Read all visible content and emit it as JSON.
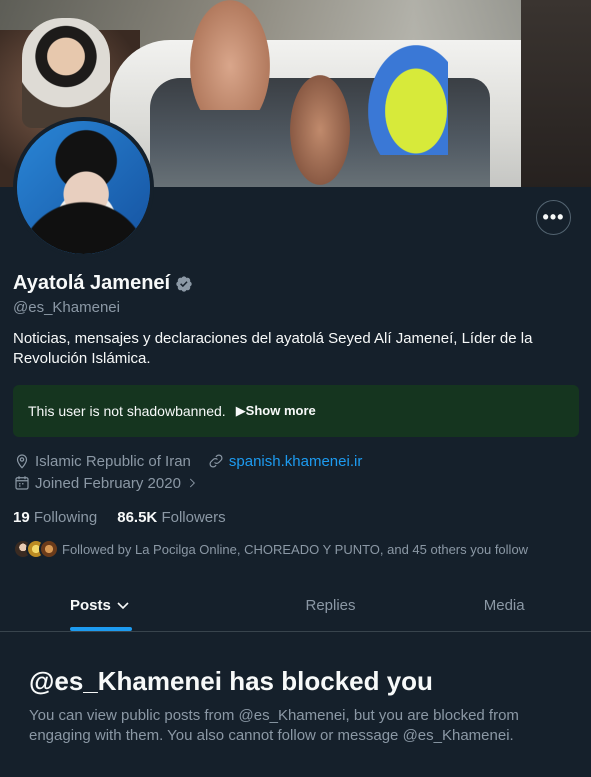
{
  "profile": {
    "name": "Ayatolá Jameneí",
    "handle": "@es_Khamenei",
    "bio": "Noticias, mensajes y declaraciones del ayatolá Seyed Alí Jameneí, Líder de la Revolución Islámica.",
    "location": "Islamic Republic of Iran",
    "website": "spanish.khamenei.ir",
    "joined": "Joined February 2020",
    "following_count": "19",
    "following_label": "Following",
    "followers_count": "86.5K",
    "followers_label": "Followers",
    "followed_by": "Followed by La Pocilga Online, CHOREADO Y PUNTO, and 45 others you follow"
  },
  "more_button": "•••",
  "shadowban": {
    "message": "This user is not shadowbanned.",
    "show_more": "▶Show more"
  },
  "tabs": [
    {
      "label": "Posts"
    },
    {
      "label": "Replies"
    },
    {
      "label": "Media"
    }
  ],
  "blocked": {
    "title": "@es_Khamenei has blocked you",
    "text": "You can view public posts from @es_Khamenei, but you are blocked from engaging with them. You also cannot follow or message @es_Khamenei."
  },
  "colors": {
    "background": "#15202b",
    "accent": "#1d9bf0",
    "muted": "#8b98a5",
    "shadow_box": "#15351f"
  }
}
